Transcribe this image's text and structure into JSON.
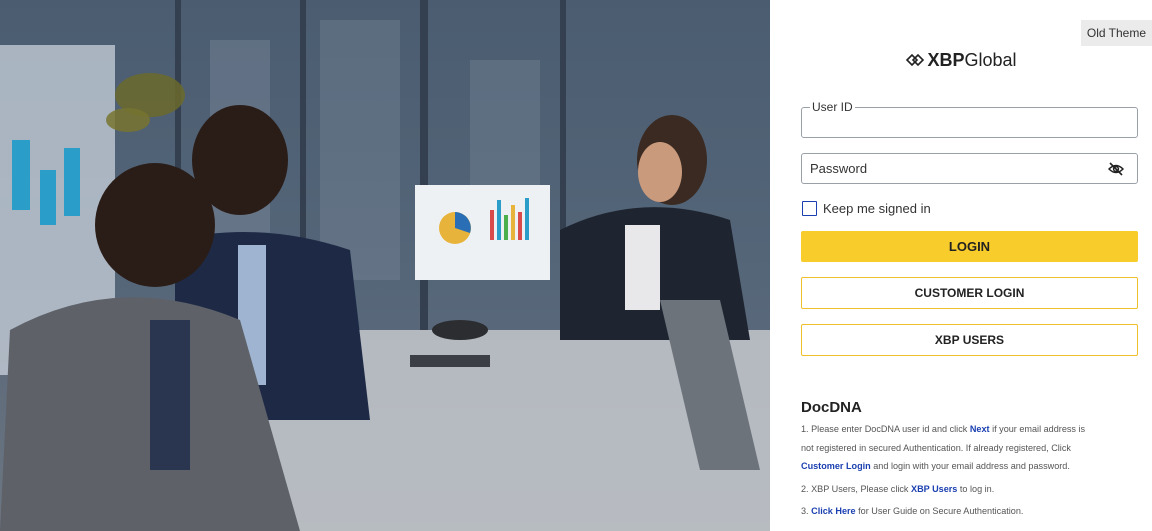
{
  "panel": {
    "old_theme": "Old Theme",
    "brand_bold": "XBP",
    "brand_rest": "Global"
  },
  "form": {
    "userid_label": "User ID",
    "userid_value": "",
    "password_placeholder": "Password",
    "keep_signed_in": "Keep me signed in",
    "login": "LOGIN",
    "customer_login": "CUSTOMER LOGIN",
    "xbp_users": "XBP USERS"
  },
  "docdna": {
    "title": "DocDNA",
    "line1a": "1. Please enter DocDNA user id and click ",
    "line1_link": "Next",
    "line1b": " if your email address is",
    "line2": "not registered in secured Authentication. If already registered, Click",
    "line3_link": "Customer Login",
    "line3b": " and login with your email address and password.",
    "line4a": "2. XBP Users, Please click ",
    "line4_link": "XBP Users",
    "line4b": " to log in.",
    "line5a": "3. ",
    "line5_link": "Click Here",
    "line5b": " for User Guide on Secure Authentication."
  },
  "colors": {
    "accent_yellow": "#f8cc2a",
    "link_blue": "#1a3fb0"
  },
  "icons": {
    "brand": "xbp-logo-icon",
    "password_toggle": "eye-off-icon",
    "checkbox": "checkbox-icon"
  }
}
